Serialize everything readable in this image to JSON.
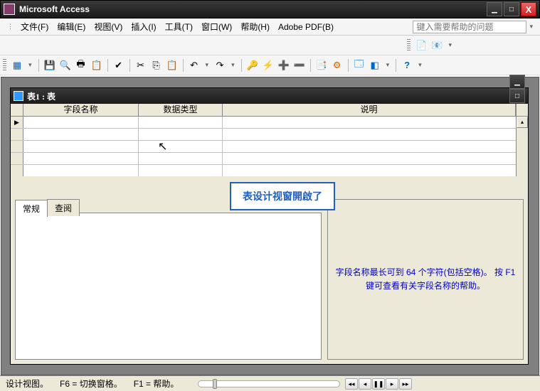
{
  "app": {
    "title": "Microsoft Access"
  },
  "menu": {
    "file": "文件(F)",
    "edit": "编辑(E)",
    "view": "视图(V)",
    "insert": "插入(I)",
    "tools": "工具(T)",
    "window": "窗口(W)",
    "help": "帮助(H)",
    "adobe": "Adobe PDF(B)"
  },
  "helpSearch": {
    "placeholder": "键入需要帮助的问题"
  },
  "childWindow": {
    "title": "表1 : 表"
  },
  "gridHeaders": {
    "fieldName": "字段名称",
    "dataType": "数据类型",
    "description": "说明"
  },
  "tabs": {
    "general": "常规",
    "lookup": "查阅"
  },
  "helpText": "字段名称最长可到 64 个字符(包括空格)。 按 F1 键可查看有关字段名称的帮助。",
  "callout": "表设计视窗開啟了",
  "status": {
    "view": "设计视图。",
    "f6": "F6 = 切换窗格。",
    "f1": "F1 = 帮助。"
  }
}
